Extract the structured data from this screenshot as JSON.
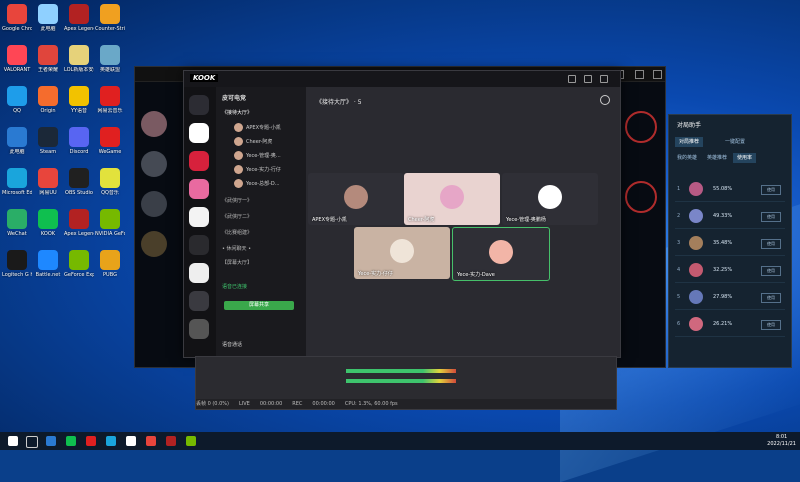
{
  "desktop": {
    "icons": [
      {
        "label": "Google Chrome",
        "color": "#e8453c"
      },
      {
        "label": "此电脑",
        "color": "#8fd0ff"
      },
      {
        "label": "Apex Legends",
        "color": "#b22222"
      },
      {
        "label": "Counter-Strike Global Offe...",
        "color": "#f0a020"
      },
      {
        "label": "VALORANT",
        "color": "#ff4655"
      },
      {
        "label": "王者荣耀",
        "color": "#e0453c"
      },
      {
        "label": "LOL新版本安装包",
        "color": "#e6d27a"
      },
      {
        "label": "英雄联盟",
        "color": "#6aa8c8"
      },
      {
        "label": "QQ",
        "color": "#1e9dea"
      },
      {
        "label": "Origin",
        "color": "#f56c2d"
      },
      {
        "label": "YY语音",
        "color": "#f2c200"
      },
      {
        "label": "网易云音乐",
        "color": "#e02020"
      },
      {
        "label": "此电脑",
        "color": "#2a7ad2"
      },
      {
        "label": "Steam",
        "color": "#1b2838"
      },
      {
        "label": "Discord",
        "color": "#5865f2"
      },
      {
        "label": "WeGame",
        "color": "#e02020"
      },
      {
        "label": "Microsoft Edge",
        "color": "#1aa5dc"
      },
      {
        "label": "网易UU",
        "color": "#e8453c"
      },
      {
        "label": "OBS Studio",
        "color": "#202020"
      },
      {
        "label": "QQ音乐",
        "color": "#e2e23c"
      },
      {
        "label": "WeChat",
        "color": "#2aae67"
      },
      {
        "label": "KOOK",
        "color": "#0fbf4f"
      },
      {
        "label": "Apex Legends",
        "color": "#b22222"
      },
      {
        "label": "NVIDIA GeForce",
        "color": "#76b900"
      },
      {
        "label": "Logitech G HUB",
        "color": "#1a1a1a"
      },
      {
        "label": "Battle.net",
        "color": "#1e88ff"
      },
      {
        "label": "GeForce Experience",
        "color": "#76b900"
      },
      {
        "label": "PUBG",
        "color": "#e8a31a"
      }
    ]
  },
  "kook": {
    "logo": "KOOK",
    "server_name": "皮可电竞",
    "channels": [
      {
        "label": "《接待大厅》",
        "active": true
      },
      {
        "label": "《武侠厅一》",
        "active": false
      },
      {
        "label": "《武侠厅二》",
        "active": false
      },
      {
        "label": "《比赛组建》",
        "active": false
      },
      {
        "label": "• 休闲聊天 •",
        "active": false
      },
      {
        "label": "【屏幕大厅】",
        "active": false
      }
    ],
    "members": [
      "APEX专题-小凯",
      "Cheer-阿虎",
      "Yece-管理-奥...",
      "Yece-实力-行仔",
      "Yece-总部-D..."
    ],
    "main_header": "《接待大厅》 · 5",
    "tiles": [
      {
        "name": "APEX专题-小凯",
        "bg": "#2f2f36",
        "avatar": "#b48a7c"
      },
      {
        "name": "Cheer-阿虎",
        "bg": "#e9d3d0",
        "avatar": "#e6a6c7"
      },
      {
        "name": "Yece-管理-奥鹏杨",
        "bg": "#2f2f36",
        "avatar": "#ffffff"
      },
      {
        "name": "Yece-实力-仔仔",
        "bg": "#c9b3a3",
        "avatar": "#efe4d8"
      },
      {
        "name": "Yece-实力-Dave",
        "bg": "#2f2f36",
        "avatar": "#f2b5a7"
      }
    ],
    "voice_status": "语音已连接",
    "share_btn": "屏幕共享",
    "footer_user": "语音通话"
  },
  "obs": {
    "status": [
      "丢帧 0 (0.0%)",
      "LIVE",
      "00:00:00",
      "REC",
      "00:00:00",
      "CPU: 1.3%, 60.00 fps"
    ]
  },
  "helper": {
    "title": "对局助手",
    "tabs": [
      "对局推荐",
      "一键配置",
      "我的英雄",
      "英雄推荐",
      "使用率"
    ],
    "rows": [
      {
        "rank": "1",
        "pct": "55.08%",
        "color": "#b75a84"
      },
      {
        "rank": "2",
        "pct": "49.33%",
        "color": "#7a86c8"
      },
      {
        "rank": "3",
        "pct": "35.48%",
        "color": "#a47f5c"
      },
      {
        "rank": "4",
        "pct": "32.25%",
        "color": "#c45a70"
      },
      {
        "rank": "5",
        "pct": "27.98%",
        "color": "#6578b8"
      },
      {
        "rank": "6",
        "pct": "26.21%",
        "color": "#d0687e"
      }
    ],
    "btn": "使用"
  },
  "taskbar": {
    "time": "8:01",
    "date": "2022/11/21"
  }
}
